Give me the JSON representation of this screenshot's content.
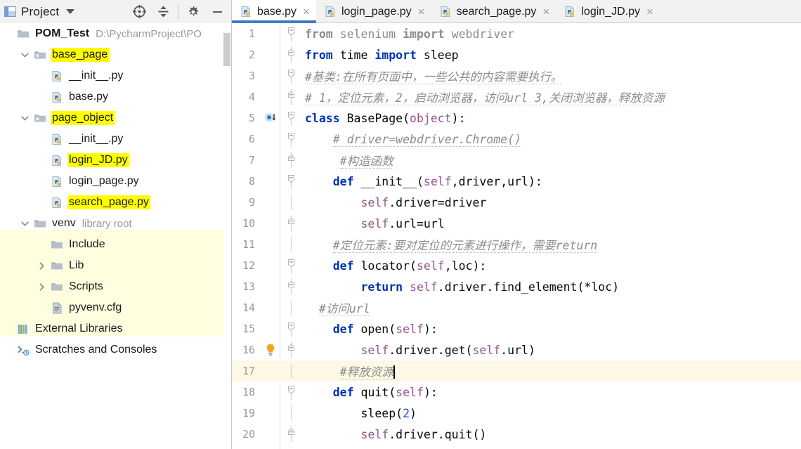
{
  "project_panel": {
    "title": "Project",
    "icons": [
      {
        "name": "locate-icon",
        "glyph": "crosshair"
      },
      {
        "name": "collapse-all-icon",
        "glyph": "collapse"
      },
      {
        "name": "settings-gear-icon",
        "glyph": "gear"
      },
      {
        "name": "hide-panel-icon",
        "glyph": "minus"
      }
    ],
    "tree": [
      {
        "label": "POM_Test",
        "path": "D:\\PycharmProject\\PO",
        "icon": "folder-icon",
        "indent": 0,
        "twisty": "",
        "bold": true,
        "highlight": false
      },
      {
        "label": "base_page",
        "path": "",
        "icon": "package-folder-icon",
        "indent": 1,
        "twisty": "down",
        "bold": false,
        "highlight": true
      },
      {
        "label": "__init__.py",
        "path": "",
        "icon": "python-file-icon",
        "indent": 2,
        "twisty": "",
        "bold": false,
        "highlight": false
      },
      {
        "label": "base.py",
        "path": "",
        "icon": "python-file-icon",
        "indent": 2,
        "twisty": "",
        "bold": false,
        "highlight": false
      },
      {
        "label": "page_object",
        "path": "",
        "icon": "package-folder-icon",
        "indent": 1,
        "twisty": "down",
        "bold": false,
        "highlight": true
      },
      {
        "label": "__init__.py",
        "path": "",
        "icon": "python-file-icon",
        "indent": 2,
        "twisty": "",
        "bold": false,
        "highlight": false
      },
      {
        "label": "login_JD.py",
        "path": "",
        "icon": "python-file-icon",
        "indent": 2,
        "twisty": "",
        "bold": false,
        "highlight": true
      },
      {
        "label": "login_page.py",
        "path": "",
        "icon": "python-file-icon",
        "indent": 2,
        "twisty": "",
        "bold": false,
        "highlight": false
      },
      {
        "label": "search_page.py",
        "path": "",
        "icon": "python-file-icon",
        "indent": 2,
        "twisty": "",
        "bold": false,
        "highlight": true
      },
      {
        "label": "venv",
        "path": "library root",
        "icon": "folder-icon",
        "indent": 1,
        "twisty": "down",
        "bold": false,
        "highlight": false
      },
      {
        "label": "Include",
        "path": "",
        "icon": "folder-icon",
        "indent": 2,
        "twisty": "",
        "bold": false,
        "highlight": false
      },
      {
        "label": "Lib",
        "path": "",
        "icon": "folder-icon",
        "indent": 2,
        "twisty": "right",
        "bold": false,
        "highlight": false
      },
      {
        "label": "Scripts",
        "path": "",
        "icon": "folder-icon",
        "indent": 2,
        "twisty": "right",
        "bold": false,
        "highlight": false
      },
      {
        "label": "pyvenv.cfg",
        "path": "",
        "icon": "config-file-icon",
        "indent": 2,
        "twisty": "",
        "bold": false,
        "highlight": false
      },
      {
        "label": "External Libraries",
        "path": "",
        "icon": "libraries-icon",
        "indent": 0,
        "twisty": "",
        "bold": false,
        "highlight": false
      },
      {
        "label": "Scratches and Consoles",
        "path": "",
        "icon": "scratches-icon",
        "indent": 0,
        "twisty": "",
        "bold": false,
        "highlight": false
      }
    ]
  },
  "editor": {
    "tabs": [
      {
        "label": "base.py",
        "active": true,
        "icon": "python-file-icon",
        "close": "×"
      },
      {
        "label": "login_page.py",
        "active": false,
        "icon": "python-file-icon",
        "close": "×"
      },
      {
        "label": "search_page.py",
        "active": false,
        "icon": "python-file-icon",
        "close": "×"
      },
      {
        "label": "login_JD.py",
        "active": false,
        "icon": "python-file-icon",
        "close": "×"
      }
    ],
    "current_line": 17,
    "lines": [
      {
        "n": "1",
        "fold": "minus-round",
        "marker": "",
        "text": "from selenium import webdriver"
      },
      {
        "n": "2",
        "fold": "top-bracket",
        "marker": "",
        "text": "from time import sleep"
      },
      {
        "n": "3",
        "fold": "minus-round",
        "marker": "",
        "text": "#基类:在所有页面中，一些公共的内容需要执行。"
      },
      {
        "n": "4",
        "fold": "top-bracket",
        "marker": "",
        "text": "# 1，定位元素，2，启动浏览器，访问url 3,关闭浏览器，释放资源"
      },
      {
        "n": "5",
        "fold": "minus-round",
        "marker": "run-class-icon",
        "text": "class BasePage(object):"
      },
      {
        "n": "6",
        "fold": "minus-round",
        "marker": "",
        "text": "    # driver=webdriver.Chrome()"
      },
      {
        "n": "7",
        "fold": "top-bracket",
        "marker": "",
        "text": "     #构造函数"
      },
      {
        "n": "8",
        "fold": "minus-round",
        "marker": "",
        "text": "    def __init__(self,driver,url):"
      },
      {
        "n": "9",
        "fold": "",
        "marker": "",
        "text": "        self.driver=driver"
      },
      {
        "n": "10",
        "fold": "top-bracket",
        "marker": "",
        "text": "        self.url=url"
      },
      {
        "n": "11",
        "fold": "",
        "marker": "",
        "text": "    #定位元素:要对定位的元素进行操作，需要return"
      },
      {
        "n": "12",
        "fold": "minus-round",
        "marker": "",
        "text": "    def locator(self,loc):"
      },
      {
        "n": "13",
        "fold": "top-bracket",
        "marker": "",
        "text": "        return self.driver.find_element(*loc)"
      },
      {
        "n": "14",
        "fold": "",
        "marker": "",
        "text": "  #访问url"
      },
      {
        "n": "15",
        "fold": "minus-round",
        "marker": "",
        "text": "    def open(self):"
      },
      {
        "n": "16",
        "fold": "top-bracket",
        "marker": "intention-bulb-icon",
        "text": "        self.driver.get(self.url)"
      },
      {
        "n": "17",
        "fold": "",
        "marker": "",
        "text": "     #释放资源"
      },
      {
        "n": "18",
        "fold": "minus-round",
        "marker": "",
        "text": "    def quit(self):"
      },
      {
        "n": "19",
        "fold": "",
        "marker": "",
        "text": "        sleep(2)"
      },
      {
        "n": "20",
        "fold": "top-bracket",
        "marker": "",
        "text": "        self.driver.quit()"
      }
    ]
  },
  "colors": {
    "highlight_yellow": "#ffff00",
    "venv_band": "#ffffe0",
    "current_line": "#fdf8e3",
    "active_tab_underline": "#3d7bc4",
    "keyword_blue": "#0033b3",
    "self_purple": "#94558d",
    "comment_gray": "#8c8c8c",
    "number_blue": "#1750eb",
    "line_number_gray": "#999999"
  }
}
